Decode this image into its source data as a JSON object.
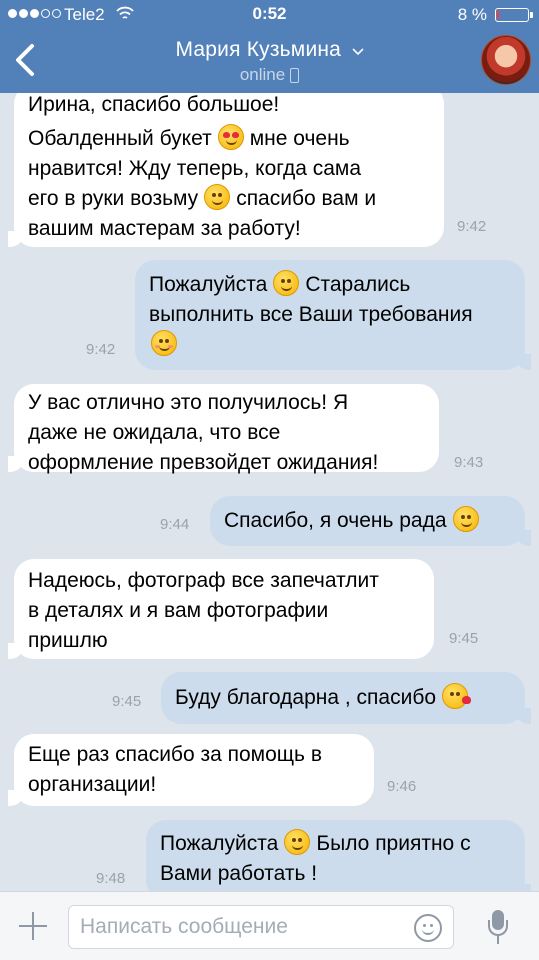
{
  "status_bar": {
    "carrier": "Tele2",
    "time": "0:52",
    "battery": "8 %",
    "battery_level": 0.08
  },
  "header": {
    "contact_name": "Мария Кузьмина",
    "presence": "online"
  },
  "messages": [
    {
      "dir": "in",
      "time": "9:42",
      "lines": [
        "Ирина, спасибо большое!",
        "Обалденный букет [heart-eyes] мне очень",
        "нравится! Жду теперь, когда сама",
        "его в руки возьму [smile] спасибо вам и",
        "вашим мастерам за работу!"
      ]
    },
    {
      "dir": "out",
      "time": "9:42",
      "lines": [
        "Пожалуйста [smile] Старались",
        "выполнить все Ваши требования",
        "[relieved]"
      ]
    },
    {
      "dir": "in",
      "time": "9:43",
      "lines": [
        "У вас отлично это получилось! Я",
        "даже не ожидала, что все",
        "оформление превзойдет ожидания!"
      ]
    },
    {
      "dir": "out",
      "time": "9:44",
      "lines": [
        "Спасибо, я очень рада [smile]"
      ]
    },
    {
      "dir": "in",
      "time": "9:45",
      "lines": [
        "Надеюсь, фотограф все запечатлит",
        "в деталях и я вам фотографии",
        "пришлю"
      ]
    },
    {
      "dir": "out",
      "time": "9:45",
      "lines": [
        "Буду благодарна , спасибо [kiss]"
      ]
    },
    {
      "dir": "in",
      "time": "9:46",
      "lines": [
        "Еще раз спасибо за помощь в",
        "организации!"
      ]
    },
    {
      "dir": "out",
      "time": "9:48",
      "lines": [
        "Пожалуйста [smile] Было приятно с",
        "Вами работать !"
      ]
    }
  ],
  "composer": {
    "placeholder": "Написать сообщение"
  },
  "colors": {
    "nav": "#5181b8",
    "background": "#dde4ec",
    "incoming_bubble": "#ffffff",
    "outgoing_bubble": "#cddcec",
    "timestamp": "#9aa3ad"
  },
  "icons": {
    "back": "chevron-left-icon",
    "wifi": "wifi-icon",
    "attach": "plus-icon",
    "emoji": "smiley-icon",
    "voice": "microphone-icon"
  }
}
